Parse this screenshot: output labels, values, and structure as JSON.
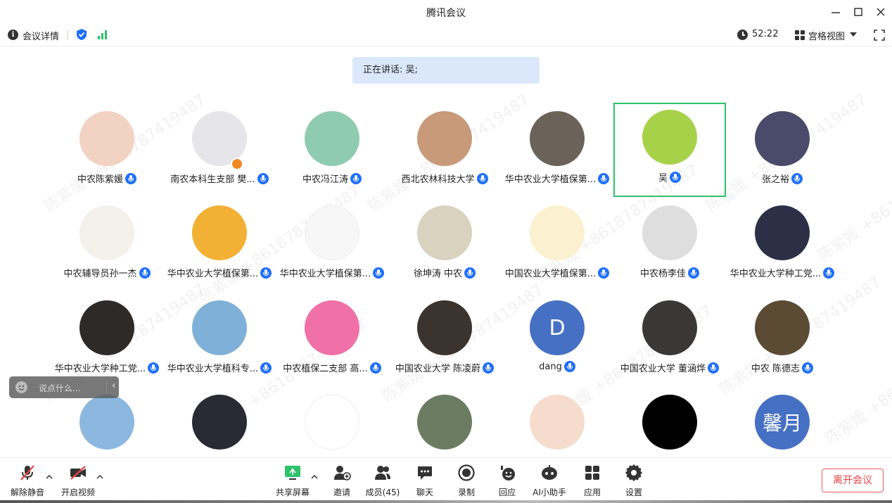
{
  "window": {
    "title": "腾讯会议"
  },
  "infobar": {
    "details_label": "会议详情",
    "timer": "52:22",
    "view_label": "宫格视图"
  },
  "speaking_banner": "正在讲话: 吴;",
  "participants": [
    {
      "name": "中农陈紫媛",
      "active": false,
      "avatar_color": "#f2d2c2"
    },
    {
      "name": "南农本科生支部 樊...",
      "active": false,
      "avatar_color": "#e6e6ea"
    },
    {
      "name": "中农冯江涛",
      "active": false,
      "avatar_color": "#8fcbb0"
    },
    {
      "name": "西北农林科技大学",
      "active": false,
      "avatar_color": "#c89a7a"
    },
    {
      "name": "华中农业大学植保第...",
      "active": false,
      "avatar_color": "#6b6259"
    },
    {
      "name": "吴",
      "active": true,
      "avatar_color": "#a8d14a"
    },
    {
      "name": "张之裕",
      "active": false,
      "avatar_color": "#4a4a6a"
    },
    {
      "name": "中农辅导员孙一杰",
      "active": false,
      "avatar_color": "#f4f0ea"
    },
    {
      "name": "华中农业大学植保第...",
      "active": false,
      "avatar_color": "#f2b134"
    },
    {
      "name": "华中农业大学植保第...",
      "active": false,
      "avatar_color": "#f7f7f7"
    },
    {
      "name": "徐坤涛 中农",
      "active": false,
      "avatar_color": "#d9d2bf"
    },
    {
      "name": "中国农业大学植保第...",
      "active": false,
      "avatar_color": "#fbf1d0"
    },
    {
      "name": "中农杨李佳",
      "active": false,
      "avatar_color": "#dedede"
    },
    {
      "name": "华中农业大学种工党...",
      "active": false,
      "avatar_color": "#2c3046"
    },
    {
      "name": "华中农业大学种工党...",
      "active": false,
      "avatar_color": "#2e2a28"
    },
    {
      "name": "华中农业大学植科专...",
      "active": false,
      "avatar_color": "#7fb0d8"
    },
    {
      "name": "中农植保二支部 高...",
      "active": false,
      "avatar_color": "#f070a8"
    },
    {
      "name": "中国农业大学 陈凌蔚",
      "active": false,
      "avatar_color": "#3b332e"
    },
    {
      "name": "dang",
      "active": false,
      "avatar_color": "#4670c4",
      "initial": "D"
    },
    {
      "name": "中国农业大学 董涵烨",
      "active": false,
      "avatar_color": "#3a3836"
    },
    {
      "name": "中农 陈德志",
      "active": false,
      "avatar_color": "#5b4a34"
    },
    {
      "name": "",
      "active": false,
      "avatar_color": "#8cb8e0"
    },
    {
      "name": "",
      "active": false,
      "avatar_color": "#2a2a34"
    },
    {
      "name": "",
      "active": false,
      "avatar_color": "#ffffff"
    },
    {
      "name": "",
      "active": false,
      "avatar_color": "#6c7c62"
    },
    {
      "name": "",
      "active": false,
      "avatar_color": "#f6dccc"
    },
    {
      "name": "",
      "active": false,
      "avatar_color": "#000000"
    },
    {
      "name": "",
      "active": false,
      "avatar_color": "#4670c4",
      "initial": "馨月"
    }
  ],
  "watermark": "陈紫媛 +8618787419487",
  "chat_popup": {
    "placeholder": "说点什么..."
  },
  "toolbar": {
    "unmute": "解除静音",
    "start_video": "开启视频",
    "share_screen": "共享屏幕",
    "invite": "邀请",
    "members": "成员(45)",
    "chat": "聊天",
    "record": "录制",
    "reaction": "回应",
    "ai_assistant": "AI小助手",
    "apps": "应用",
    "settings": "设置",
    "leave": "离开会议"
  },
  "colors": {
    "accent_blue": "#1e6fff",
    "active_speaker_border": "#2dc26b",
    "leave_red": "#e64545",
    "banner_bg": "#dbe8fb"
  }
}
